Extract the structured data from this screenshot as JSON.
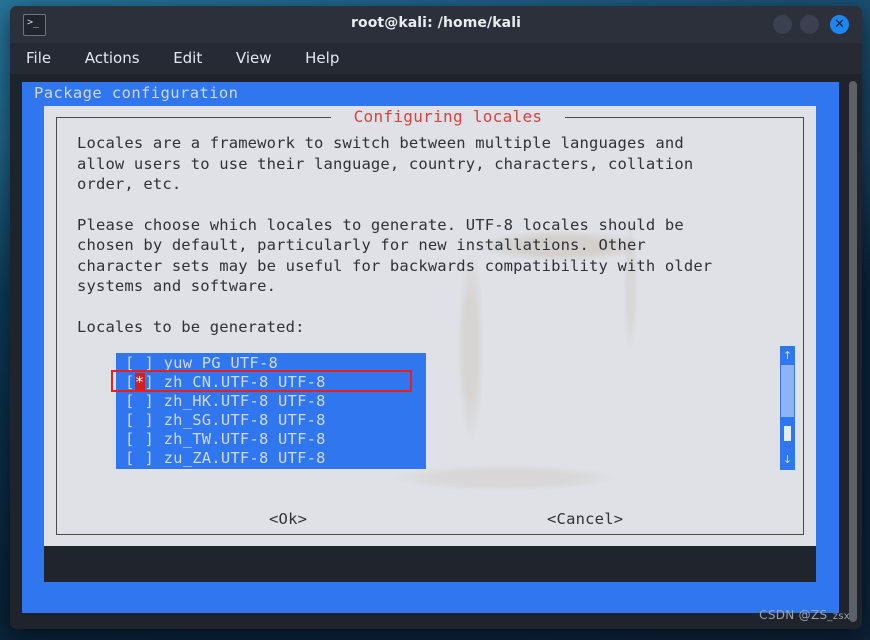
{
  "window": {
    "title": "root@kali: /home/kali",
    "icon": "terminal-icon",
    "controls": {
      "minimize": "",
      "maximize": "",
      "close": "✕"
    }
  },
  "menubar": {
    "items": [
      {
        "label": "File"
      },
      {
        "label": "Actions"
      },
      {
        "label": "Edit"
      },
      {
        "label": "View"
      },
      {
        "label": "Help"
      }
    ]
  },
  "terminal": {
    "package_config_header": "Package configuration"
  },
  "dialog": {
    "title": "Configuring locales",
    "paragraphs": [
      "Locales are a framework to switch between multiple languages and\nallow users to use their language, country, characters, collation\norder, etc.",
      "Please choose which locales to generate. UTF-8 locales should be\nchosen by default, particularly for new installations. Other\ncharacter sets may be useful for backwards compatibility with older\nsystems and software.",
      "Locales to be generated:"
    ],
    "list": {
      "items": [
        {
          "checked": false,
          "label": "yuw_PG UTF-8"
        },
        {
          "checked": true,
          "label": "zh_CN.UTF-8 UTF-8"
        },
        {
          "checked": false,
          "label": "zh_HK.UTF-8 UTF-8"
        },
        {
          "checked": false,
          "label": "zh_SG.UTF-8 UTF-8"
        },
        {
          "checked": false,
          "label": "zh_TW.UTF-8 UTF-8"
        },
        {
          "checked": false,
          "label": "zu_ZA.UTF-8 UTF-8"
        }
      ],
      "check_mark": "*",
      "bracket_open": "[",
      "bracket_close": "]",
      "scroll_up_arrow": "↑",
      "scroll_down_arrow": "↓"
    },
    "buttons": {
      "ok": "<Ok>",
      "cancel": "<Cancel>"
    }
  },
  "annotation": {
    "highlight_color": "#ee1d1d",
    "highlight_target": "zh_CN.UTF-8 UTF-8"
  },
  "watermark": {
    "main": "CSDN @ZS",
    "sub": "_zsx"
  },
  "colors": {
    "whiptail_blue": "#2f76ef",
    "dialog_gray": "#dfe1e6",
    "title_red": "#d2453f",
    "check_red": "#d1201f",
    "close_blue": "#1d86f5"
  }
}
